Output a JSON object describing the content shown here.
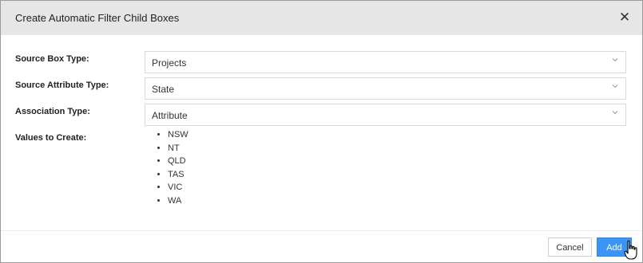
{
  "dialog": {
    "title": "Create Automatic Filter Child Boxes",
    "close_icon": "close-icon"
  },
  "form": {
    "source_box_type": {
      "label": "Source Box Type:",
      "value": "Projects"
    },
    "source_attribute_type": {
      "label": "Source Attribute Type:",
      "value": "State"
    },
    "association_type": {
      "label": "Association Type:",
      "value": "Attribute"
    },
    "values_to_create": {
      "label": "Values to Create:",
      "items": [
        "NSW",
        "NT",
        "QLD",
        "TAS",
        "VIC",
        "WA"
      ]
    }
  },
  "footer": {
    "cancel_label": "Cancel",
    "add_label": "Add"
  },
  "colors": {
    "header_bg": "#e6e6e6",
    "primary": "#3a95f4"
  },
  "icons": [
    "close-icon",
    "chevron-down-icon",
    "hand-pointer-icon"
  ]
}
